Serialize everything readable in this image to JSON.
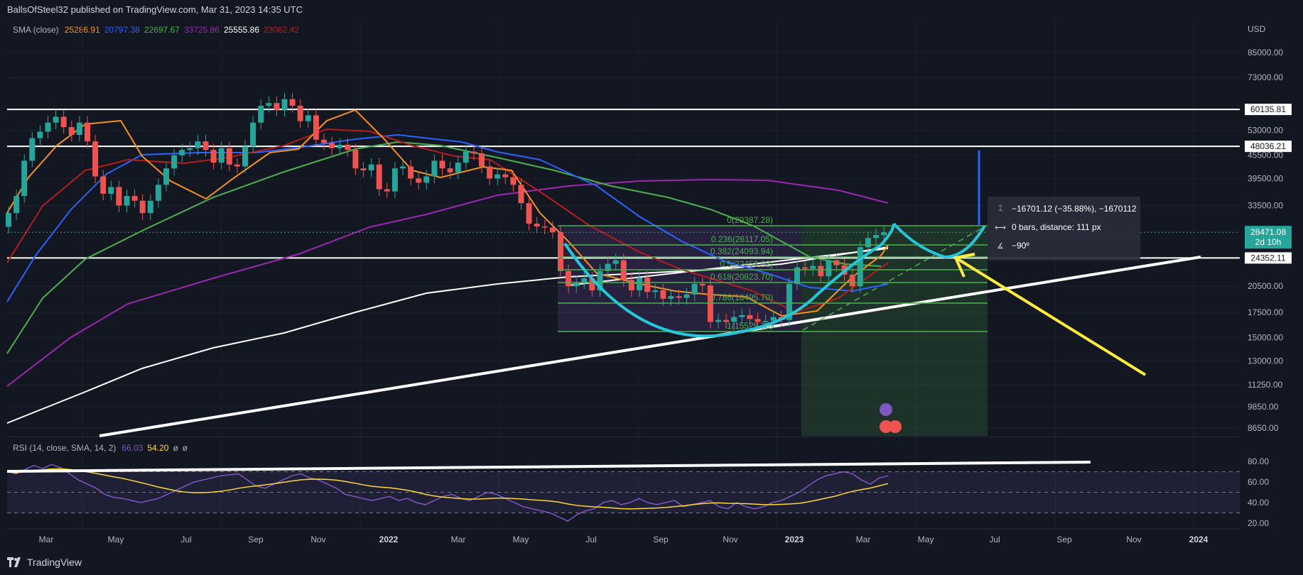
{
  "header": {
    "publisher": "BallsOfSteel32 published on TradingView.com, Mar 31, 2023 14:35 UTC"
  },
  "sma_legend": {
    "label": "SMA (close)",
    "values": [
      {
        "text": "25286.91",
        "color": "#f7931a"
      },
      {
        "text": "20797.38",
        "color": "#2962ff"
      },
      {
        "text": "22697.67",
        "color": "#4caf50"
      },
      {
        "text": "33725.86",
        "color": "#9c27b0"
      },
      {
        "text": "25555.86",
        "color": "#ffffff"
      },
      {
        "text": "23062.42",
        "color": "#b71c1c"
      }
    ]
  },
  "rsi_legend": {
    "label": "RSI (14, close, SMA, 14, 2)",
    "values": [
      {
        "text": "66.03",
        "color": "#7e57c2"
      },
      {
        "text": "54.20",
        "color": "#fdd835"
      },
      {
        "text": "ø",
        "color": "#b2b5be"
      },
      {
        "text": "ø",
        "color": "#b2b5be"
      }
    ]
  },
  "tooltip": {
    "line1": "−16701.12 (−35.88%), −1670112",
    "line2": "0 bars, distance: 111 px",
    "line3": "−90º"
  },
  "footer": {
    "brand": "TradingView"
  },
  "colors": {
    "background": "#131722",
    "up": "#26a69a",
    "down": "#ef5350",
    "fib": "#4caf50",
    "arc": "#26c6da",
    "arrow": "#ffeb3b"
  },
  "chart_data": {
    "type": "line",
    "title": "",
    "currency": "USD",
    "x_tick_labels": [
      "Mar",
      "May",
      "Jul",
      "Sep",
      "Nov",
      "2022",
      "Mar",
      "May",
      "Jul",
      "Sep",
      "Nov",
      "2023",
      "Mar",
      "May",
      "Jul",
      "Sep",
      "Nov",
      "2024"
    ],
    "y_tick_labels": [
      "85000.00",
      "73000.00",
      "53000.00",
      "45500.00",
      "39500.00",
      "33500.00",
      "20500.00",
      "17500.00",
      "15000.00",
      "13000.00",
      "11250.00",
      "9850.00",
      "8650.00"
    ],
    "y_scale": "log",
    "horizontal_levels": [
      {
        "value": 60135.81,
        "label": "60135.81"
      },
      {
        "value": 48036.21,
        "label": "48036.21"
      },
      {
        "value": 24352.11,
        "label": "24352.11"
      }
    ],
    "last_price": {
      "value": 28471.08,
      "label": "28471.08",
      "countdown": "2d 10h"
    },
    "fibonacci": [
      {
        "ratio": 0,
        "price": 29387.28,
        "label": "0(29387.28)"
      },
      {
        "ratio": 0.236,
        "price": 26117.05,
        "label": "0.236(26117.05)"
      },
      {
        "ratio": 0.382,
        "price": 24093.94,
        "label": "0.382(24093.94)"
      },
      {
        "ratio": 0.5,
        "price": 22458.82,
        "label": "0.5(22458.82)"
      },
      {
        "ratio": 0.618,
        "price": 20823.7,
        "label": "0.618(20823.70)"
      },
      {
        "ratio": 0.786,
        "price": 18495.7,
        "label": "0.786(18495.70)"
      },
      {
        "ratio": 1,
        "price": 15529.36,
        "label": "1(15529.36)"
      }
    ],
    "weekly_close": [
      32000,
      35500,
      44000,
      50500,
      52500,
      55500,
      57500,
      54000,
      51500,
      55500,
      49500,
      40000,
      36000,
      37500,
      33500,
      35500,
      34500,
      32000,
      34500,
      38000,
      42000,
      45500,
      47000,
      47500,
      49500,
      47000,
      43500,
      47500,
      43000,
      42500,
      48000,
      55500,
      61500,
      62500,
      60000,
      64000,
      61500,
      56000,
      58000,
      50000,
      49000,
      47500,
      48500,
      47000,
      42000,
      41500,
      43000,
      37000,
      36500,
      42000,
      42500,
      39500,
      38500,
      40000,
      44000,
      42000,
      41000,
      43500,
      46500,
      46000,
      42500,
      39500,
      40500,
      39800,
      38000,
      34000,
      30000,
      29500,
      29300,
      28500,
      22500,
      20500,
      21000,
      21500,
      20000,
      22500,
      23500,
      24000,
      21300,
      20000,
      21600,
      19800,
      20000,
      19000,
      19300,
      19100,
      19500,
      20800,
      20600,
      16500,
      16700,
      16500,
      17000,
      17200,
      16800,
      16500,
      16600,
      17000,
      16700,
      20800,
      23000,
      22800,
      23200,
      21800,
      24000,
      23300,
      22000,
      20500,
      26000,
      27500,
      28000,
      28471
    ],
    "rsi": [
      70,
      68,
      72,
      76,
      73,
      77,
      74,
      68,
      62,
      58,
      54,
      48,
      45,
      44,
      42,
      40,
      42,
      44,
      48,
      52,
      56,
      60,
      62,
      64,
      66,
      67,
      68,
      62,
      56,
      54,
      58,
      62,
      66,
      68,
      64,
      62,
      58,
      54,
      48,
      46,
      44,
      42,
      44,
      46,
      42,
      44,
      40,
      38,
      42,
      46,
      48,
      44,
      42,
      46,
      50,
      48,
      44,
      40,
      36,
      34,
      32,
      30,
      26,
      22,
      28,
      32,
      34,
      40,
      42,
      38,
      40,
      44,
      40,
      38,
      40,
      42,
      36,
      38,
      40,
      42,
      36,
      34,
      40,
      36,
      34,
      36,
      40,
      42,
      46,
      50,
      56,
      62,
      66,
      68,
      70,
      68,
      62,
      58,
      64,
      66
    ],
    "rsi_axis": [
      "80.00",
      "60.00",
      "40.00",
      "20.00"
    ]
  }
}
